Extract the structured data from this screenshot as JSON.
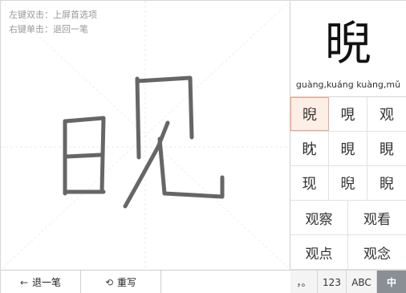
{
  "hints": {
    "line1": "左键双击：上屏首选项",
    "line2": "右键单击：退回一笔"
  },
  "toolbar": {
    "undo_icon": "←",
    "undo_label": "退一笔",
    "rewrite_icon": "⟲",
    "rewrite_label": "重写"
  },
  "preview": {
    "character": "晲",
    "pinyin": "guàng,kuáng kuàng,mǔ"
  },
  "candidates_single": [
    [
      "晲",
      "哯",
      "观"
    ],
    [
      "眈",
      "晛",
      "睍"
    ],
    [
      "现",
      "晲",
      "睨"
    ]
  ],
  "candidates_words": [
    [
      "观察",
      "观看"
    ],
    [
      "观点",
      "观念"
    ]
  ],
  "modes": {
    "punct": "，。",
    "numbers": "123",
    "latin": "ABC",
    "chinese": "中"
  },
  "colors": {
    "ink": "#666666",
    "selected_bg": "#fdeee6",
    "selected_border": "#f0a582",
    "active_mode_bg": "#8a8f95"
  }
}
